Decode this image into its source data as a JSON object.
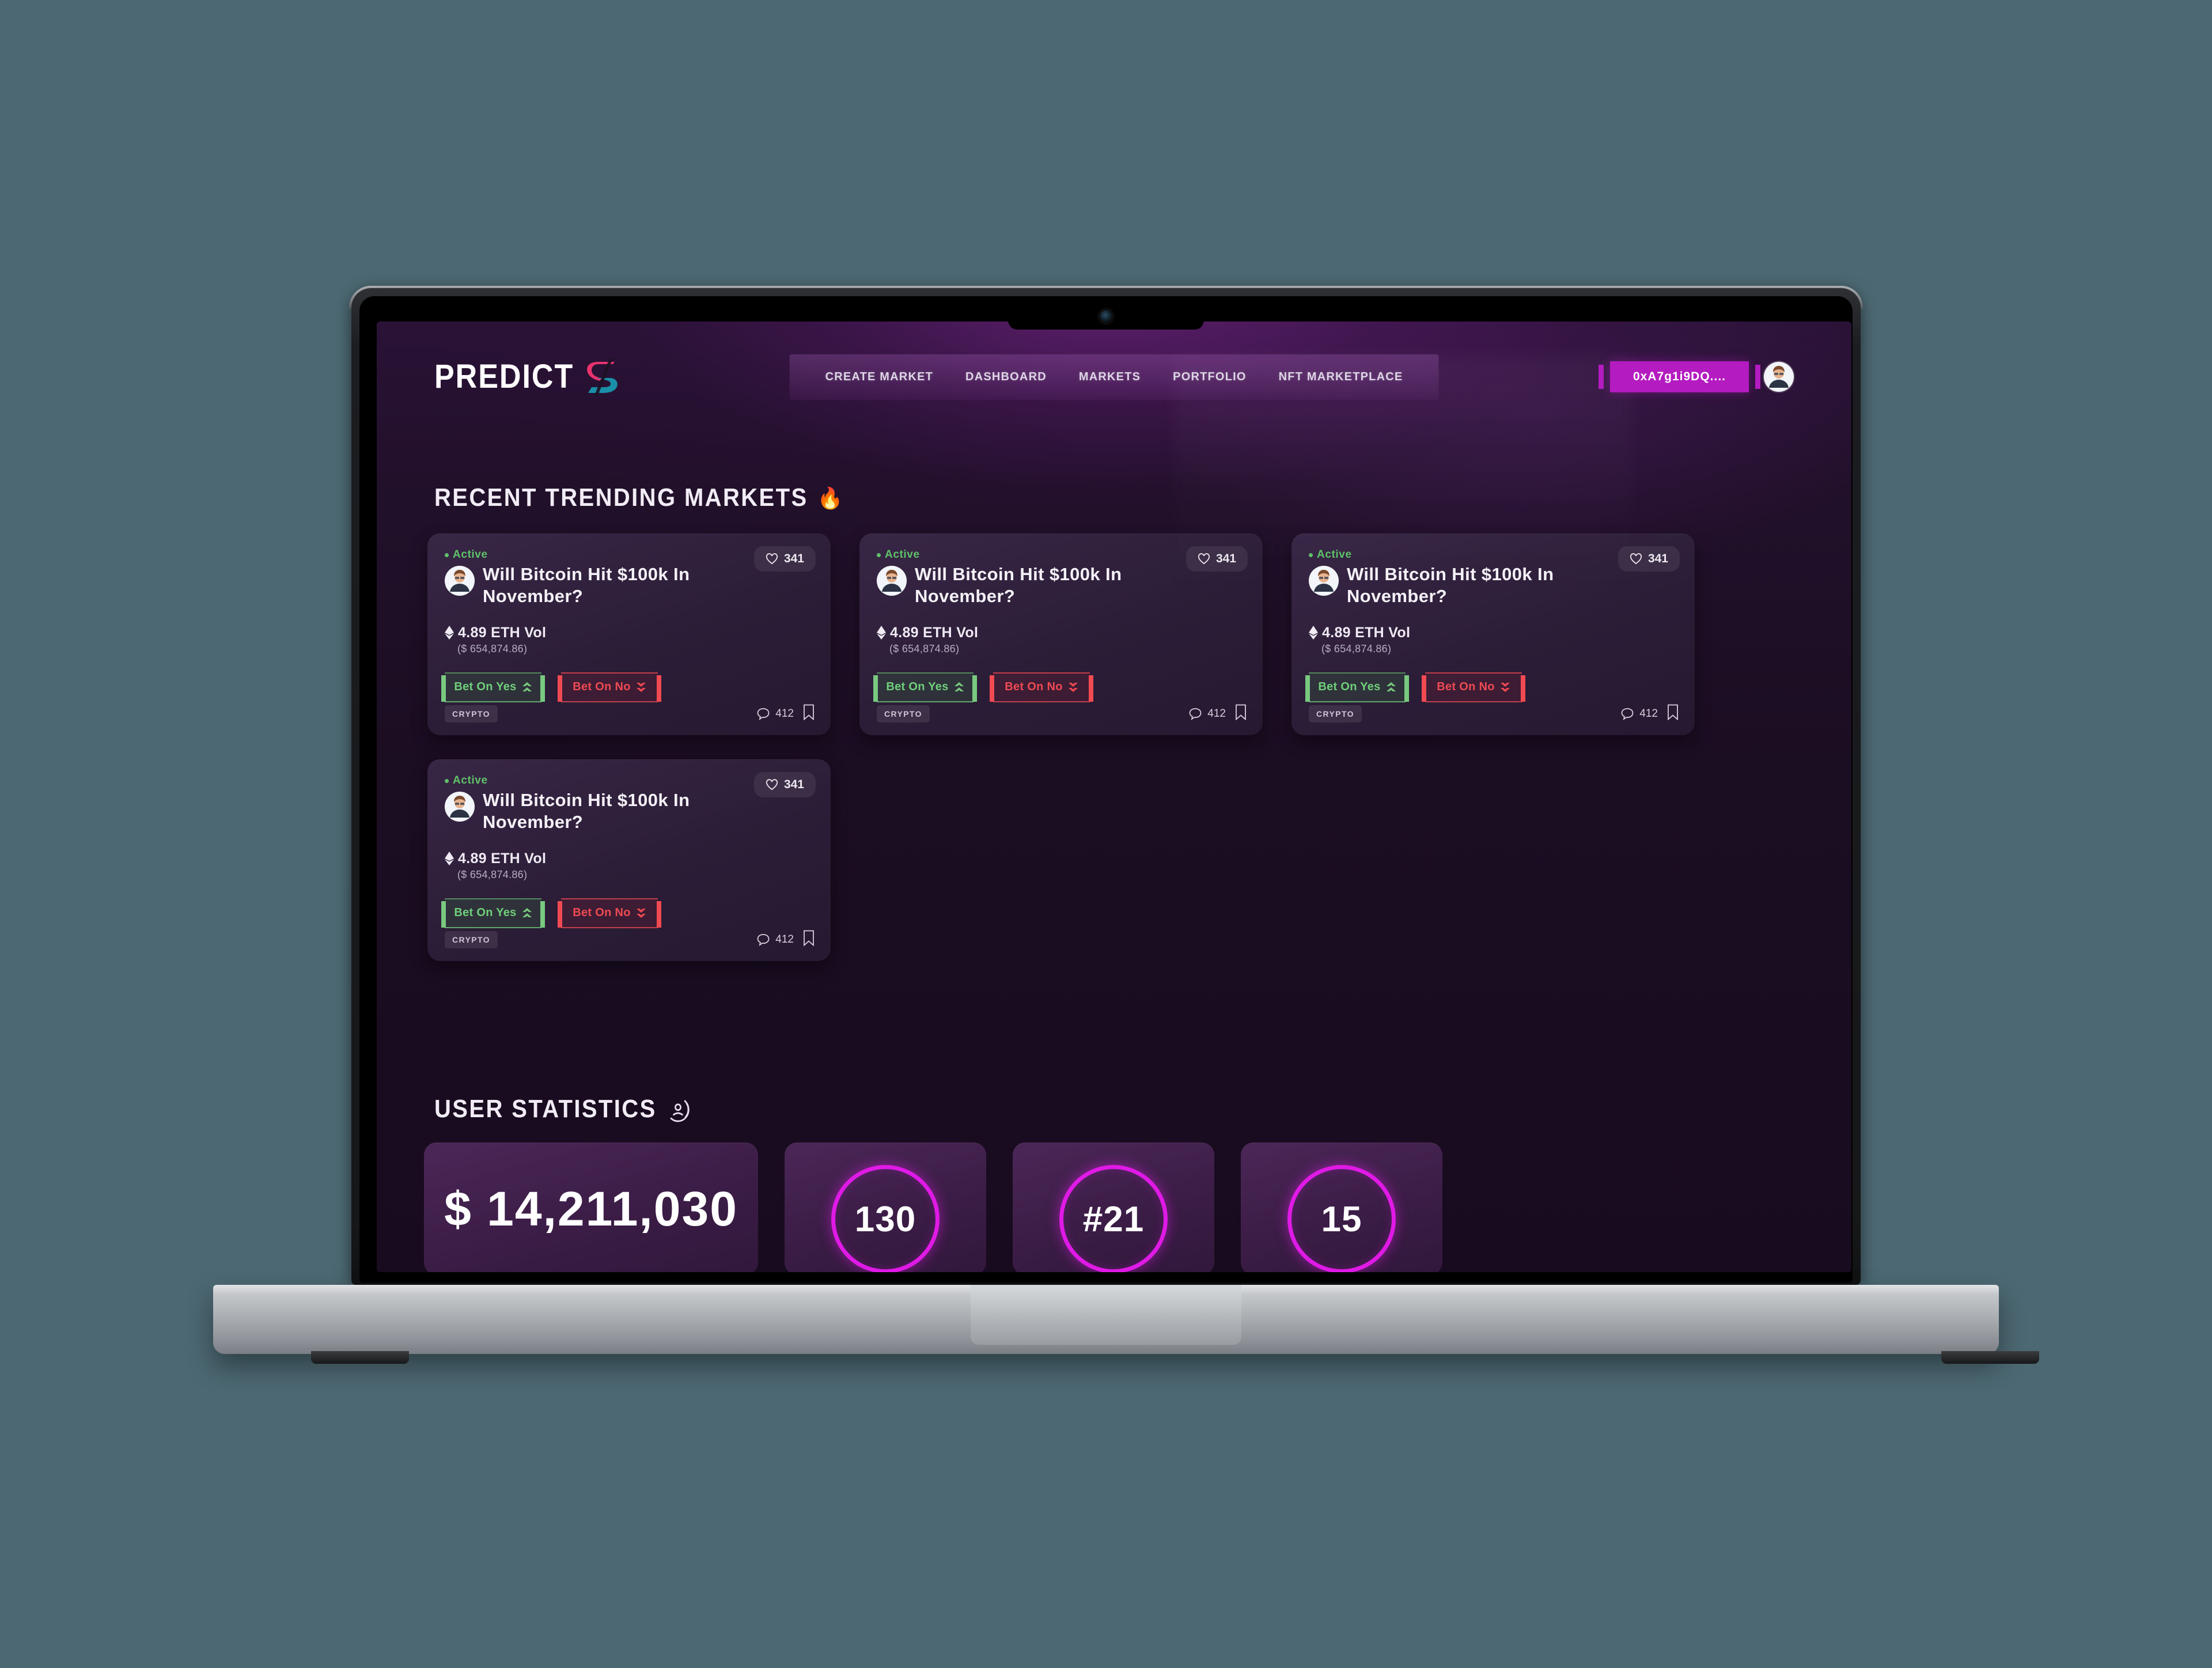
{
  "brand": {
    "word": "PREDICT",
    "mark_top_color": "#e8336e",
    "mark_bottom_color": "#1a8fa8"
  },
  "nav": {
    "items": [
      {
        "label": "CREATE MARKET"
      },
      {
        "label": "DASHBOARD"
      },
      {
        "label": "MARKETS"
      },
      {
        "label": "PORTFOLIO"
      },
      {
        "label": "NFT MARKETPLACE"
      }
    ]
  },
  "wallet": {
    "address": "0xA7g1i9DQ....",
    "color": "#b41bc0"
  },
  "sections": {
    "trending": {
      "title": "RECENT TRENDING MARKETS",
      "emoji": "🔥"
    },
    "stats": {
      "title": "USER STATISTICS"
    }
  },
  "card_defaults": {
    "status": "Active",
    "status_color": "#5fc26a",
    "title": "Will Bitcoin Hit $100k In November?",
    "likes": "341",
    "volume": "4.89 ETH Vol",
    "volume_usd": "($ 654,874.86)",
    "bet_yes": "Bet On Yes",
    "bet_no": "Bet On No",
    "tag": "CRYPTO",
    "comments": "412",
    "yes_color": "#6fd07a",
    "no_color": "#ef4a52"
  },
  "cards": [
    {
      "status": "Active",
      "title": "Will Bitcoin Hit $100k In November?",
      "likes": "341",
      "volume": "4.89 ETH Vol",
      "volume_usd": "($ 654,874.86)",
      "bet_yes": "Bet On Yes",
      "bet_no": "Bet On No",
      "tag": "CRYPTO",
      "comments": "412"
    },
    {
      "status": "Active",
      "title": "Will Bitcoin Hit $100k In November?",
      "likes": "341",
      "volume": "4.89 ETH Vol",
      "volume_usd": "($ 654,874.86)",
      "bet_yes": "Bet On Yes",
      "bet_no": "Bet On No",
      "tag": "CRYPTO",
      "comments": "412"
    },
    {
      "status": "Active",
      "title": "Will Bitcoin Hit $100k In November?",
      "likes": "341",
      "volume": "4.89 ETH Vol",
      "volume_usd": "($ 654,874.86)",
      "bet_yes": "Bet On Yes",
      "bet_no": "Bet On No",
      "tag": "CRYPTO",
      "comments": "412"
    },
    {
      "status": "Active",
      "title": "Will Bitcoin Hit $100k In November?",
      "likes": "341",
      "volume": "4.89 ETH Vol",
      "volume_usd": "($ 654,874.86)",
      "bet_yes": "Bet On Yes",
      "bet_no": "Bet On No",
      "tag": "CRYPTO",
      "comments": "412"
    }
  ],
  "user_statistics": {
    "total_volume": "$ 14,211,030",
    "markets_count": "130",
    "rank": "#21",
    "badges": "15",
    "ring_color": "#e01ae6"
  }
}
